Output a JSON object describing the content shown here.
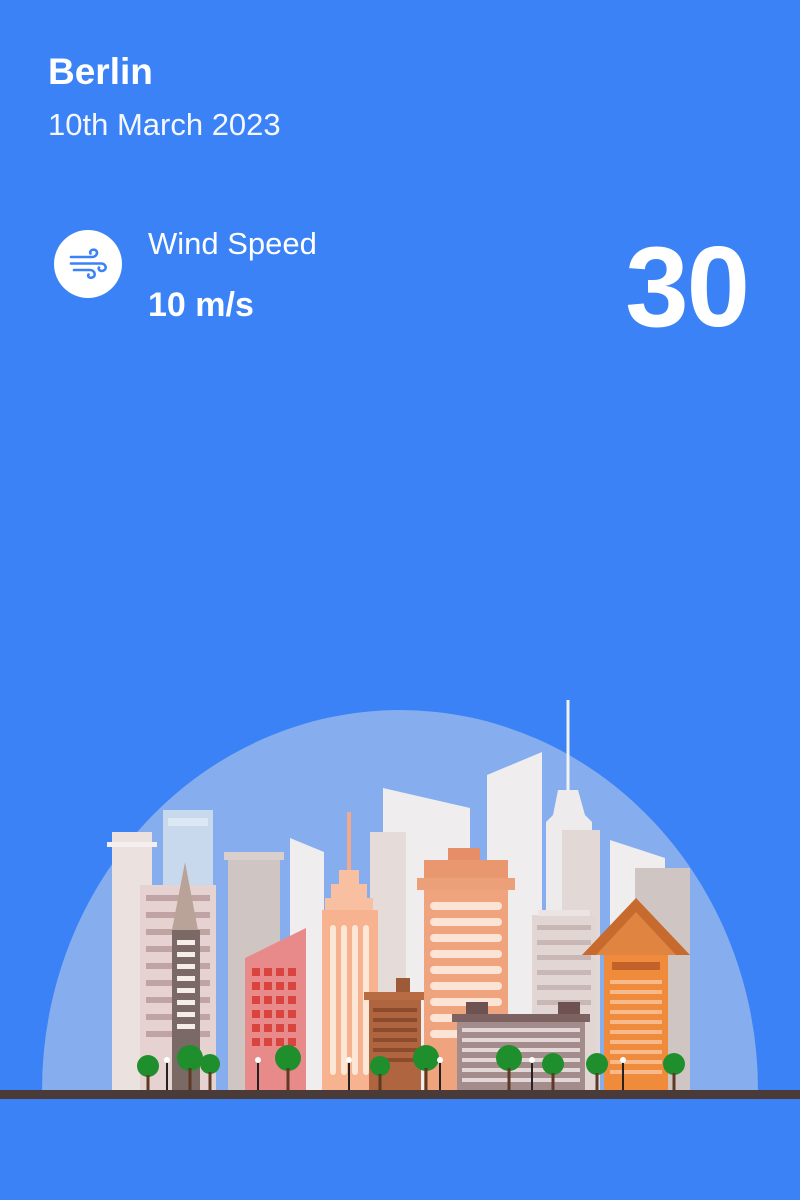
{
  "location": {
    "city": "Berlin",
    "date": "10th March 2023"
  },
  "wind": {
    "icon": "wind-icon",
    "label": "Wind Speed",
    "value": "10 m/s"
  },
  "temperature": {
    "value": "30"
  },
  "colors": {
    "background": "#3A82F6",
    "text": "#FFFFFF",
    "dome": "#86ADEE",
    "ground": "#4A3A38"
  }
}
